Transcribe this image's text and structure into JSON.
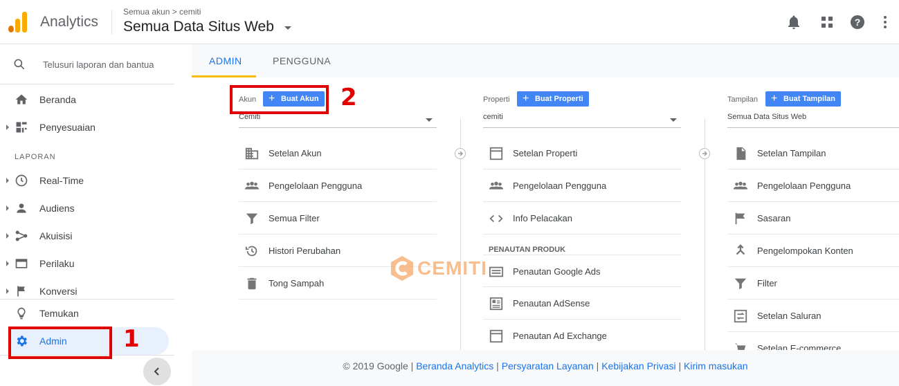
{
  "header": {
    "app_name": "Analytics",
    "breadcrumb": "Semua akun > cemiti",
    "view_title": "Semua Data Situs Web"
  },
  "sidebar": {
    "search_placeholder": "Telusuri laporan dan bantuan",
    "items": [
      {
        "label": "Beranda",
        "icon": "home-icon"
      },
      {
        "label": "Penyesuaian",
        "icon": "dashboard-icon"
      }
    ],
    "section_label": "LAPORAN",
    "report_items": [
      {
        "label": "Real-Time",
        "icon": "clock-icon"
      },
      {
        "label": "Audiens",
        "icon": "person-icon"
      },
      {
        "label": "Akuisisi",
        "icon": "acquisition-icon"
      },
      {
        "label": "Perilaku",
        "icon": "behavior-icon"
      },
      {
        "label": "Konversi",
        "icon": "flag-icon"
      }
    ],
    "temukan": "Temukan",
    "admin": "Admin"
  },
  "tabs": [
    {
      "label": "ADMIN",
      "active": true
    },
    {
      "label": "PENGGUNA",
      "active": false
    }
  ],
  "columns": {
    "akun": {
      "label": "Akun",
      "button": "Buat Akun",
      "selected": "Cemiti",
      "items": [
        "Setelan Akun",
        "Pengelolaan Pengguna",
        "Semua Filter",
        "Histori Perubahan",
        "Tong Sampah"
      ]
    },
    "properti": {
      "label": "Properti",
      "button": "Buat Properti",
      "selected": "cemiti",
      "items": [
        "Setelan Properti",
        "Pengelolaan Pengguna",
        "Info Pelacakan"
      ],
      "sub_heading": "PENAUTAN PRODUK",
      "product_items": [
        "Penautan Google Ads",
        "Penautan AdSense",
        "Penautan Ad Exchange"
      ]
    },
    "tampilan": {
      "label": "Tampilan",
      "button": "Buat Tampilan",
      "selected": "Semua Data Situs Web",
      "items": [
        "Setelan Tampilan",
        "Pengelolaan Pengguna",
        "Sasaran",
        "Pengelompokan Konten",
        "Filter",
        "Setelan Saluran",
        "Setelan E-commerce"
      ]
    }
  },
  "annotations": {
    "num1": "1",
    "num2": "2"
  },
  "watermark": "CEMITI",
  "footer": {
    "copyright": "© 2019 Google",
    "sep": " | ",
    "links": [
      "Beranda Analytics",
      "Persyaratan Layanan",
      "Kebijakan Privasi",
      "Kirim masukan"
    ]
  },
  "colors": {
    "accent": "#4285f4",
    "tab_active": "#1a73e8",
    "annotation_red": "#e00000",
    "logo_orange": "#f9ab00",
    "logo_dark": "#e37400"
  }
}
